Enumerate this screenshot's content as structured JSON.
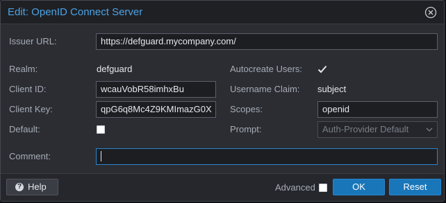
{
  "dialog": {
    "title": "Edit: OpenID Connect Server"
  },
  "form": {
    "issuer_url_label": "Issuer URL:",
    "issuer_url_value": "https://defguard.mycompany.com/",
    "realm_label": "Realm:",
    "realm_value": "defguard",
    "client_id_label": "Client ID:",
    "client_id_value": "wcauVobR58imhxBu",
    "client_key_label": "Client Key:",
    "client_key_value": "qpG6q8Mc4Z9KMImazG0X",
    "default_label": "Default:",
    "default_checked": false,
    "autocreate_users_label": "Autocreate Users:",
    "autocreate_users_checked": true,
    "username_claim_label": "Username Claim:",
    "username_claim_value": "subject",
    "scopes_label": "Scopes:",
    "scopes_value": "openid",
    "prompt_label": "Prompt:",
    "prompt_value": "Auth-Provider Default",
    "comment_label": "Comment:",
    "comment_value": ""
  },
  "footer": {
    "help_label": "Help",
    "advanced_label": "Advanced",
    "advanced_checked": false,
    "ok_label": "OK",
    "reset_label": "Reset"
  },
  "colors": {
    "accent": "#4aa3e6",
    "primary_button": "#1976b9",
    "background": "#2b2d33"
  }
}
